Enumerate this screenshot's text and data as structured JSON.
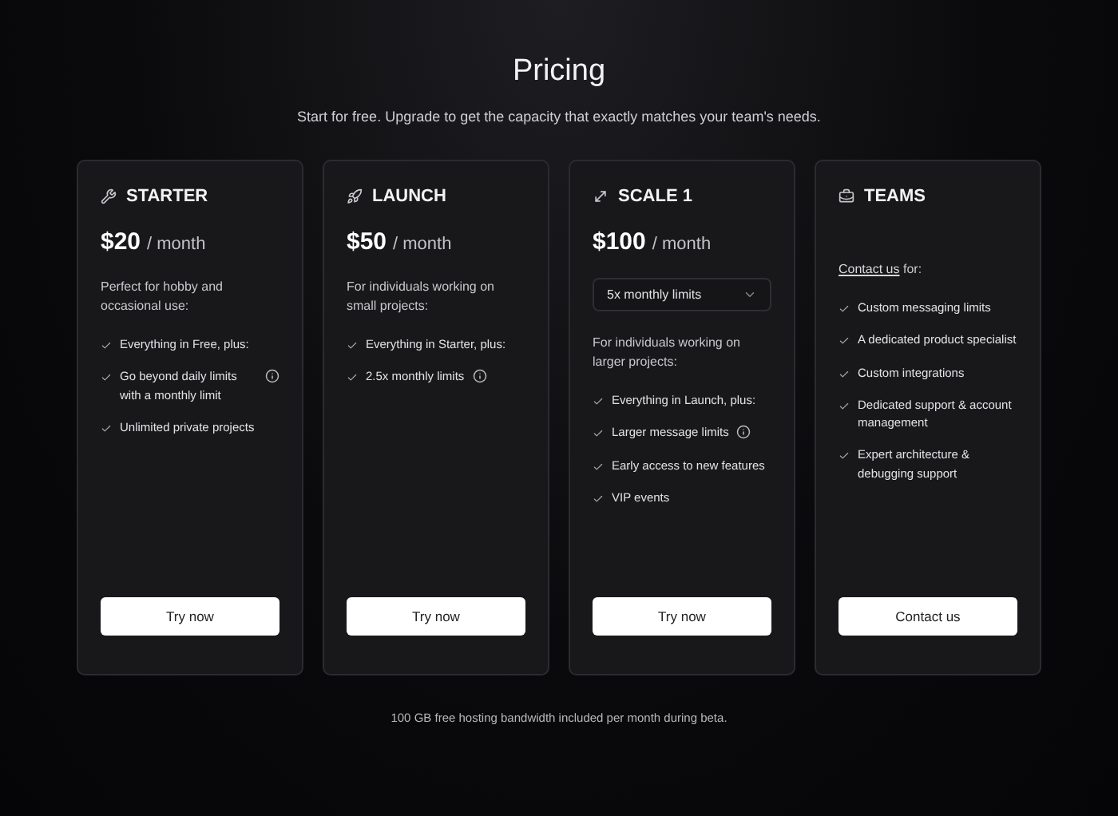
{
  "title": "Pricing",
  "subtitle": "Start for free. Upgrade to get the capacity that exactly matches your team's needs.",
  "plans": [
    {
      "kind": "tools",
      "name": "STARTER",
      "price": "$20",
      "period": "/ month",
      "description": "Perfect for hobby and occasional use:",
      "features": [
        {
          "text": "Everything in Free, plus:",
          "info": false
        },
        {
          "text": "Go beyond daily limits with a monthly limit",
          "info": true
        },
        {
          "text": "Unlimited private projects",
          "info": false
        }
      ],
      "button": "Try now"
    },
    {
      "kind": "rocket",
      "name": "LAUNCH",
      "price": "$50",
      "period": "/ month",
      "description": "For individuals working on small projects:",
      "features": [
        {
          "text": "Everything in Starter, plus:",
          "info": false
        },
        {
          "text": "2.5x monthly limits",
          "info": true
        }
      ],
      "button": "Try now"
    },
    {
      "kind": "expand",
      "name": "SCALE 1",
      "price": "$100",
      "period": "/ month",
      "dropdown": "5x monthly limits",
      "description": "For individuals working on larger projects:",
      "features": [
        {
          "text": "Everything in Launch, plus:",
          "info": false
        },
        {
          "text": "Larger message limits",
          "info": true
        },
        {
          "text": "Early access to new features",
          "info": false
        },
        {
          "text": "VIP events",
          "info": false
        }
      ],
      "button": "Try now"
    },
    {
      "kind": "briefcase",
      "name": "TEAMS",
      "description_link": "Contact us",
      "description": "for:",
      "features": [
        {
          "text": "Custom messaging limits",
          "info": false
        },
        {
          "text": "A dedicated product specialist",
          "info": false
        },
        {
          "text": "Custom integrations",
          "info": false
        },
        {
          "text": "Dedicated support & account management",
          "info": false
        },
        {
          "text": "Expert architecture & debugging support",
          "info": false
        }
      ],
      "button": "Contact us"
    }
  ],
  "footnote": "100 GB free hosting bandwidth included per month during beta."
}
